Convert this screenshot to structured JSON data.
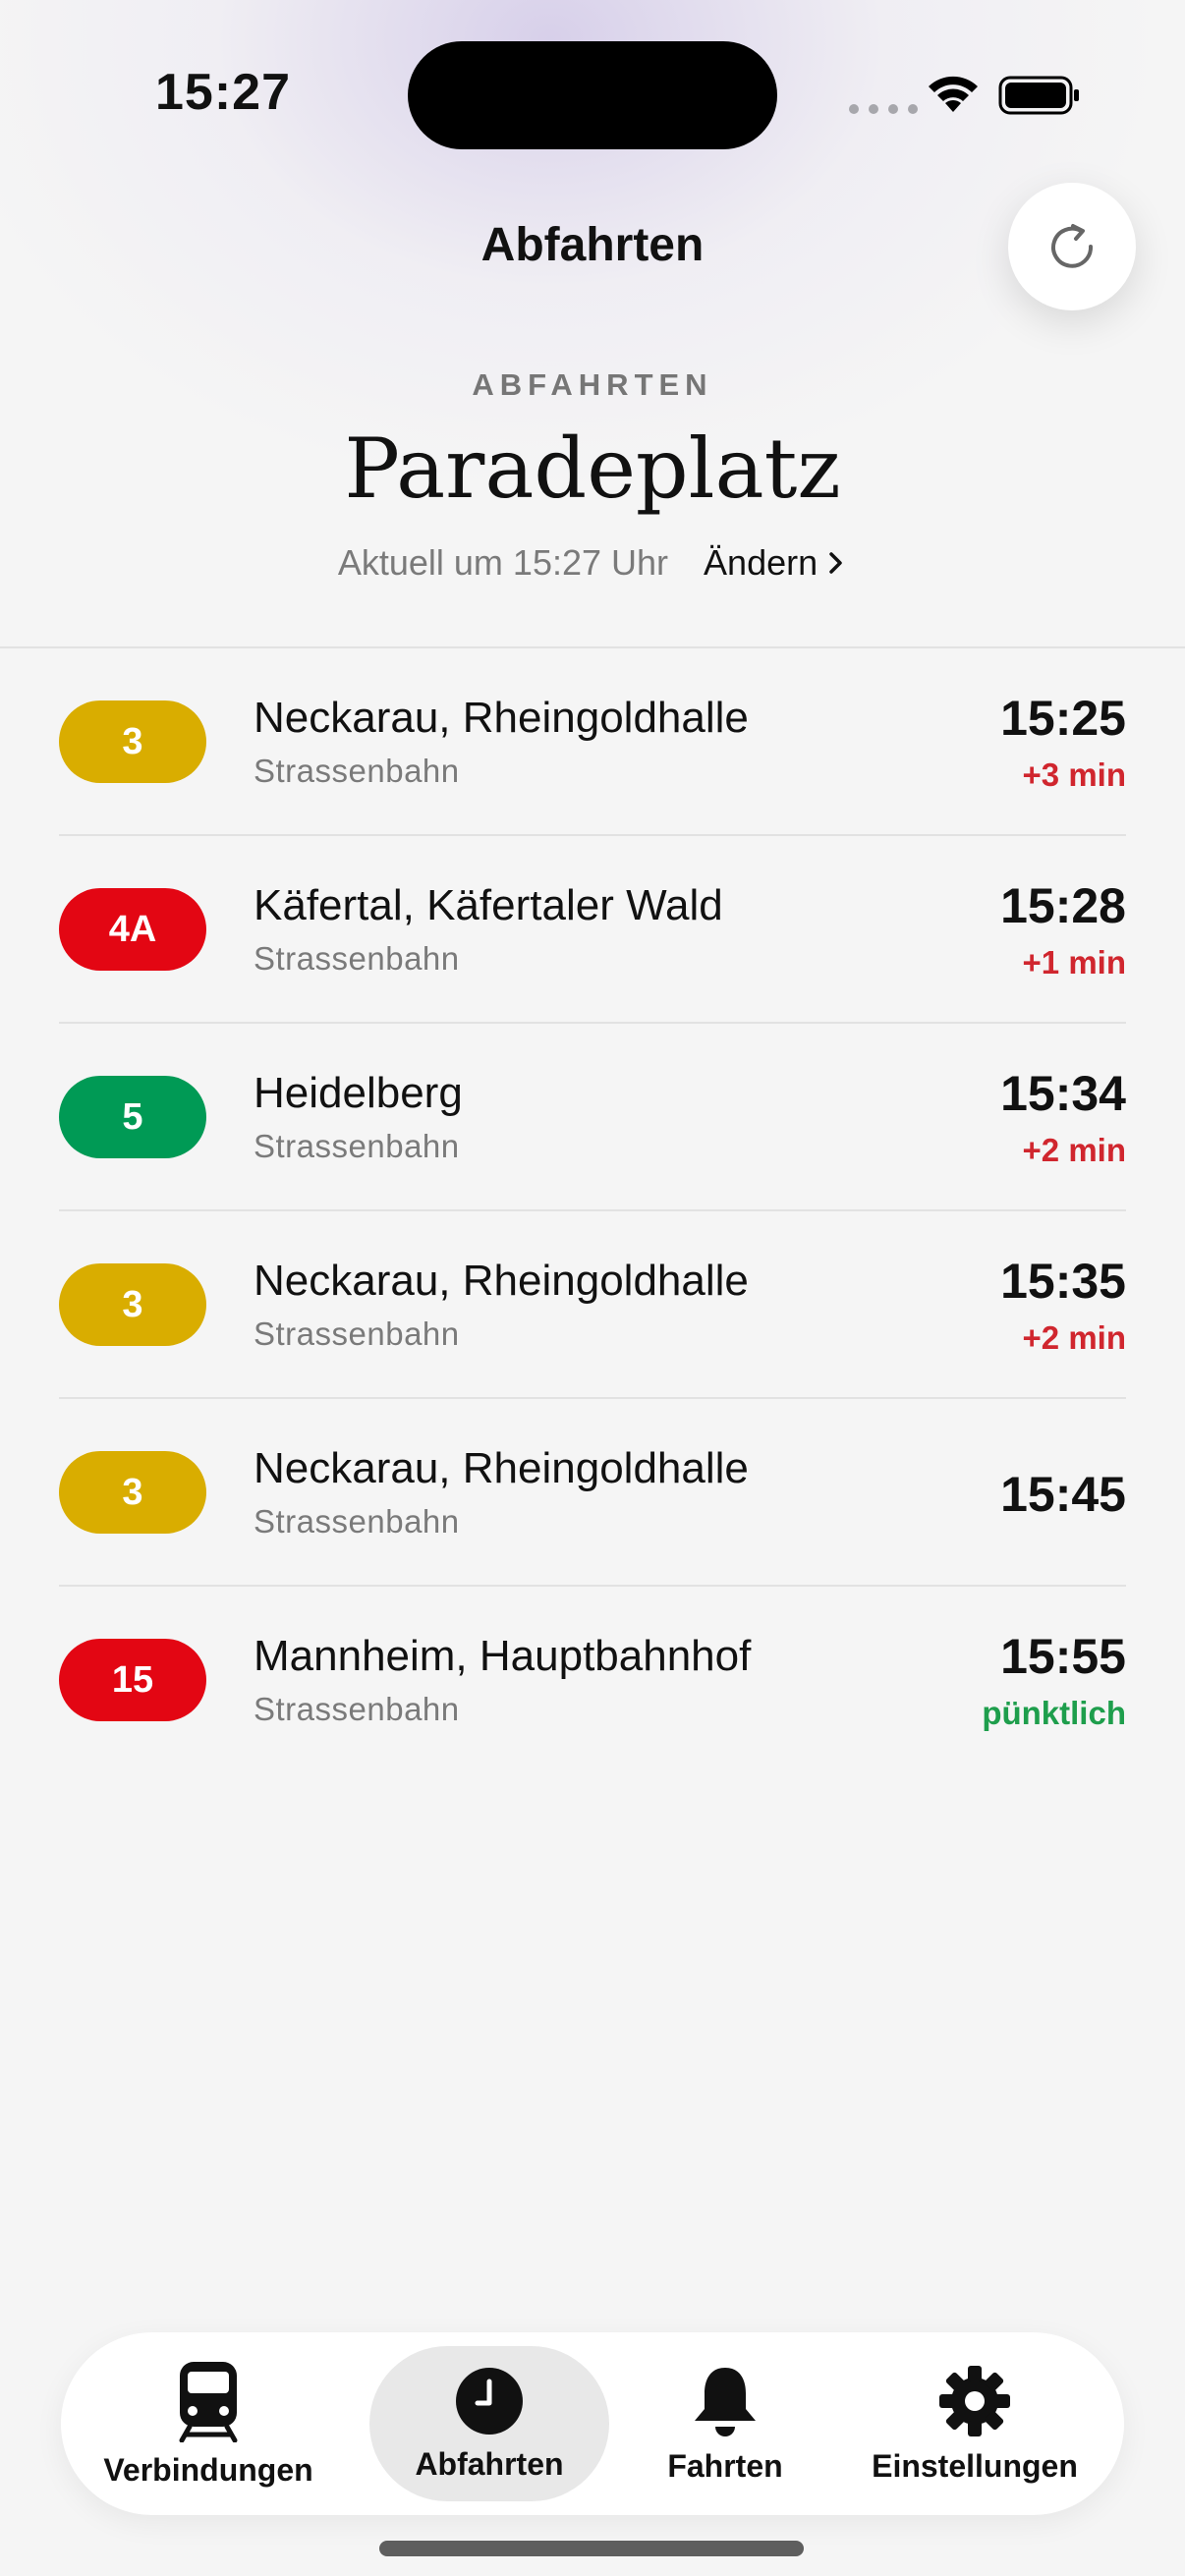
{
  "status_bar": {
    "time": "15:27"
  },
  "header": {
    "nav_title": "Abfahrten",
    "eyebrow": "ABFAHRTEN",
    "station": "Paradeplatz",
    "updated": "Aktuell um 15:27 Uhr",
    "change_label": "Ändern",
    "refresh_icon": "refresh-icon"
  },
  "departures": [
    {
      "line": "3",
      "line_color": "#d9ad00",
      "destination": "Neckarau, Rheingoldhalle",
      "mode": "Strassenbahn",
      "time": "15:25",
      "delay": "+3 min",
      "delay_color": "#d0262e"
    },
    {
      "line": "4A",
      "line_color": "#e30613",
      "destination": "Käfertal, Käfertaler Wald",
      "mode": "Strassenbahn",
      "time": "15:28",
      "delay": "+1 min",
      "delay_color": "#d0262e"
    },
    {
      "line": "5",
      "line_color": "#009a55",
      "destination": "Heidelberg",
      "mode": "Strassenbahn",
      "time": "15:34",
      "delay": "+2 min",
      "delay_color": "#d0262e"
    },
    {
      "line": "3",
      "line_color": "#d9ad00",
      "destination": "Neckarau, Rheingoldhalle",
      "mode": "Strassenbahn",
      "time": "15:35",
      "delay": "+2 min",
      "delay_color": "#d0262e"
    },
    {
      "line": "3",
      "line_color": "#d9ad00",
      "destination": "Neckarau, Rheingoldhalle",
      "mode": "Strassenbahn",
      "time": "15:45",
      "delay": "",
      "delay_color": "#d0262e"
    },
    {
      "line": "15",
      "line_color": "#e30613",
      "destination": "Mannheim, Hauptbahnhof",
      "mode": "Strassenbahn",
      "time": "15:55",
      "delay": "pünktlich",
      "delay_color": "#1e9e4c"
    }
  ],
  "tab_bar": {
    "tabs": [
      {
        "label": "Verbindungen",
        "icon": "tram-icon",
        "active": false
      },
      {
        "label": "Abfahrten",
        "icon": "clock-icon",
        "active": true
      },
      {
        "label": "Fahrten",
        "icon": "bell-icon",
        "active": false
      },
      {
        "label": "Einstellungen",
        "icon": "gear-icon",
        "active": false
      }
    ]
  }
}
